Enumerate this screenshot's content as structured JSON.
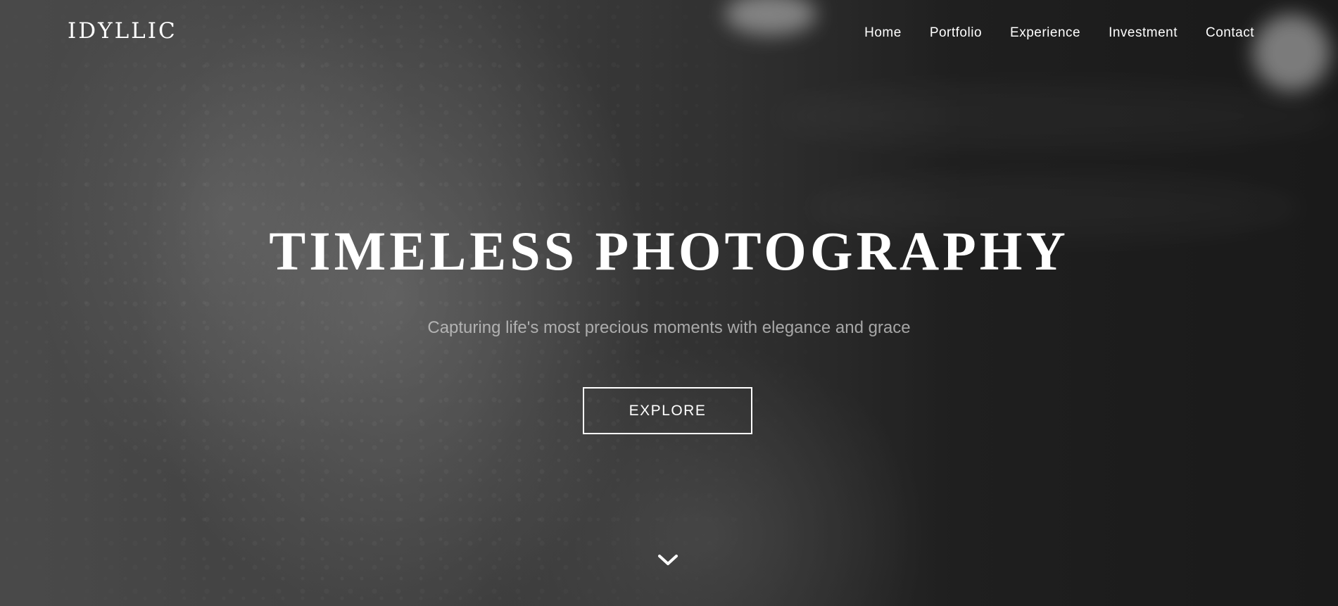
{
  "brand": {
    "logo_text": "IDYLLIC"
  },
  "nav": {
    "items": [
      {
        "label": "Home"
      },
      {
        "label": "Portfolio"
      },
      {
        "label": "Experience"
      },
      {
        "label": "Investment"
      },
      {
        "label": "Contact"
      }
    ]
  },
  "hero": {
    "title": "TIMELESS PHOTOGRAPHY",
    "subtitle": "Capturing life's most precious moments with elegance and grace",
    "cta_label": "EXPLORE",
    "scroll_icon": "chevron-down-icon",
    "background_image": "black-and-white lace wedding dress photo"
  },
  "colors": {
    "text": "#ffffff",
    "subtitle": "#bdbdbd",
    "background_dark": "#202020",
    "background_light": "#5a5a5a"
  }
}
